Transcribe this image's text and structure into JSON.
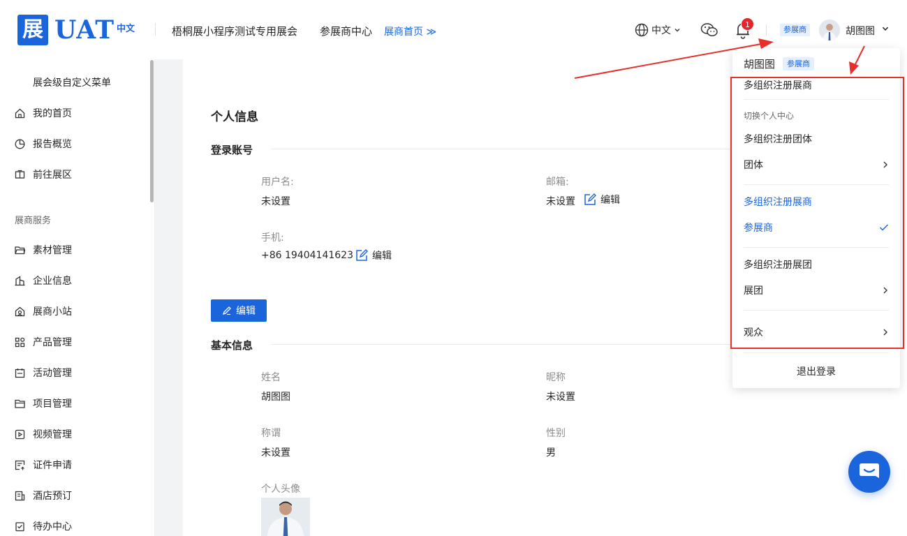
{
  "header": {
    "logo_char": "展",
    "logo_text": "UAT",
    "logo_lang": "中文",
    "expo_name": "梧桐展小程序测试专用展会",
    "center_name": "参展商中心",
    "home_link": "展商首页 ≫",
    "language": "中文",
    "notification_count": "1",
    "role_tag": "参展商",
    "user_name": "胡图图"
  },
  "sidebar": {
    "custom_menu": "展会级自定义菜单",
    "top_items": [
      {
        "label": "我的首页",
        "icon": "home-icon"
      },
      {
        "label": "报告概览",
        "icon": "pie-chart-icon"
      },
      {
        "label": "前往展区",
        "icon": "booth-icon"
      }
    ],
    "section_label": "展商服务",
    "service_items": [
      {
        "label": "素材管理",
        "icon": "folder-open-icon"
      },
      {
        "label": "企业信息",
        "icon": "building-icon"
      },
      {
        "label": "展商小站",
        "icon": "store-icon"
      },
      {
        "label": "产品管理",
        "icon": "grid-icon"
      },
      {
        "label": "活动管理",
        "icon": "calendar-icon"
      },
      {
        "label": "项目管理",
        "icon": "folder-icon"
      },
      {
        "label": "视频管理",
        "icon": "video-icon"
      },
      {
        "label": "证件申请",
        "icon": "id-card-icon"
      },
      {
        "label": "酒店预订",
        "icon": "hotel-icon"
      },
      {
        "label": "待办中心",
        "icon": "todo-icon"
      }
    ]
  },
  "main": {
    "title": "个人信息",
    "login_section": "登录账号",
    "username_label": "用户名:",
    "username_value": "未设置",
    "email_label": "邮箱:",
    "email_value": "未设置",
    "edit_label": "编辑",
    "phone_label": "手机:",
    "phone_value": "+86 19404141623",
    "edit_button": "编辑",
    "basic_section": "基本信息",
    "name_label": "姓名",
    "name_value": "胡图图",
    "nickname_label": "昵称",
    "nickname_value": "未设置",
    "title_label": "称谓",
    "title_value": "未设置",
    "gender_label": "性别",
    "gender_value": "男",
    "avatar_label": "个人头像"
  },
  "dropdown": {
    "user_name": "胡图图",
    "role_tag": "参展商",
    "current_org": "多组织注册展商",
    "switch_label": "切换个人中心",
    "groups": [
      {
        "org": "多组织注册团体",
        "role": "团体",
        "active": false
      },
      {
        "org": "多组织注册展商",
        "role": "参展商",
        "active": true
      },
      {
        "org": "多组织注册展团",
        "role": "展团",
        "active": false
      }
    ],
    "audience": "观众",
    "logout": "退出登录"
  },
  "colors": {
    "brand": "#1a64dc",
    "annotation": "#e5302c",
    "badge": "#e5242b"
  }
}
